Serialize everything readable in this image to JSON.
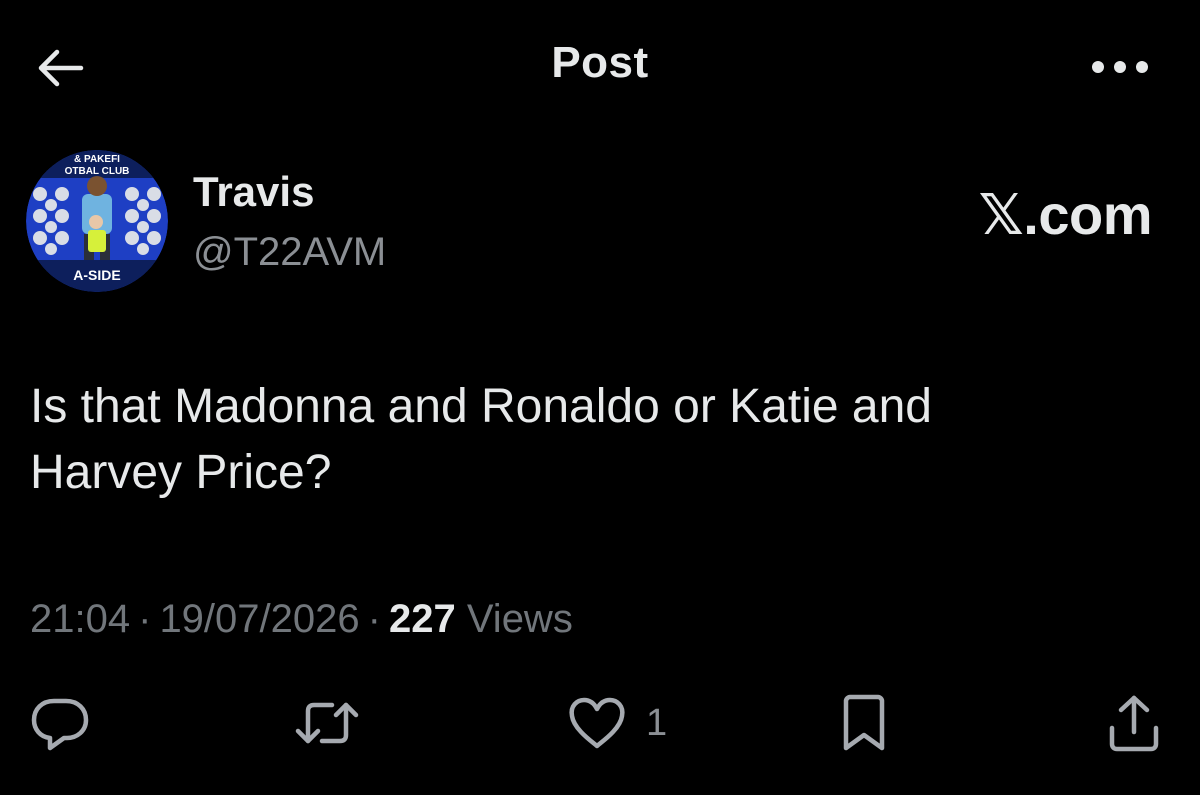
{
  "header": {
    "title": "Post",
    "back_icon": "arrow-left-icon",
    "more_icon": "more-horizontal-icon"
  },
  "author": {
    "name": "Travis",
    "handle": "@T22AVM",
    "avatar_text_top": "& PAKEFI",
    "avatar_text_mid": "OTBAL CLUB",
    "avatar_text_bottom": "A-SIDE"
  },
  "watermark": "𝕏.com",
  "post": {
    "text_line1": "Is that Madonna and Ronaldo or Katie and",
    "text_line2": "Harvey Price?"
  },
  "meta": {
    "time": "21:04",
    "date": "19/07/2026",
    "views_count": "227",
    "views_label": "Views",
    "separator": "·"
  },
  "actions": {
    "reply_icon": "reply-icon",
    "repost_icon": "repost-icon",
    "like_icon": "like-icon",
    "like_count": "1",
    "bookmark_icon": "bookmark-icon",
    "share_icon": "share-icon"
  },
  "colors": {
    "background": "#000000",
    "primary_text": "#e7e9ea",
    "secondary_text": "#71767b",
    "avatar_blue": "#1e3fc4"
  }
}
